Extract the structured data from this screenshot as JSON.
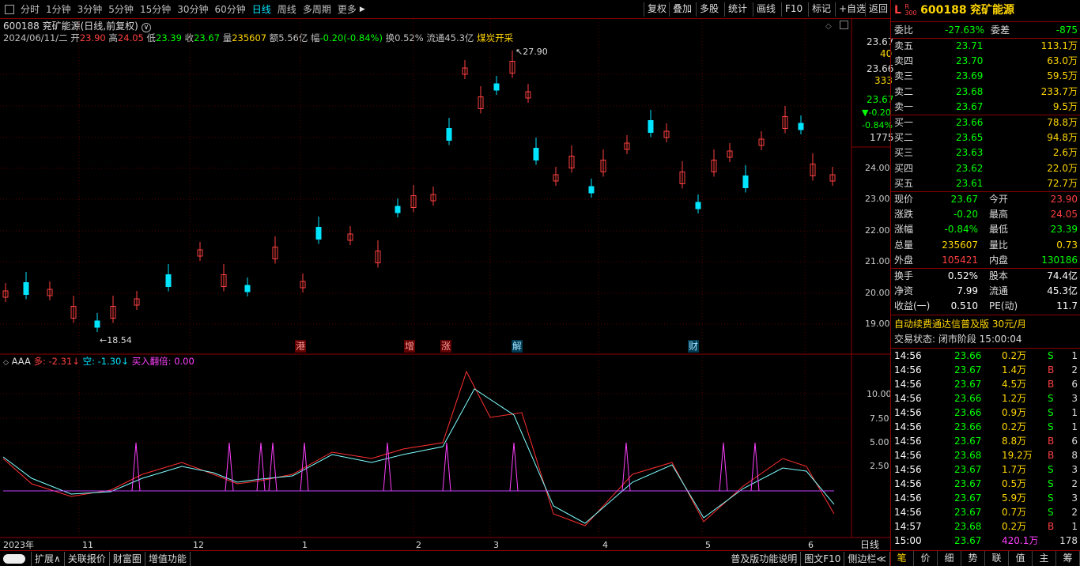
{
  "toolbar": {
    "periods": [
      "分时",
      "1分钟",
      "3分钟",
      "5分钟",
      "15分钟",
      "30分钟",
      "60分钟",
      "日线",
      "周线",
      "多周期",
      "更多"
    ],
    "active_index": 7,
    "tools": [
      "复权",
      "叠加",
      "多股",
      "统计",
      "画线",
      "F10",
      "标记",
      "+自选",
      "返回"
    ]
  },
  "info": {
    "line1": "600188 兖矿能源(日线,前复权)",
    "date": "2024/06/11/二",
    "open_l": "开",
    "open": "23.90",
    "high_l": "高",
    "high": "24.05",
    "low_l": "低",
    "low": "23.39",
    "close_l": "收",
    "close": "23.67",
    "vol_l": "量",
    "vol": "235607",
    "amt": "额5.56亿",
    "chg_l": "幅",
    "chg": "-0.20(-0.84%)",
    "turn": "换0.52%",
    "float": "流通45.3亿",
    "concept": "煤炭开采"
  },
  "chart_annotations": {
    "high_mark": "27.90",
    "low_mark": "18.54",
    "events": [
      "港",
      "增",
      "涨",
      "解",
      "财"
    ]
  },
  "price_axis": {
    "labels": [
      "24.00",
      "23.00",
      "22.00",
      "21.00",
      "20.00",
      "19.00"
    ],
    "top_box": [
      "23.67",
      "40",
      "23.66",
      "333",
      "23.67",
      "▼-0.20",
      "-0.84%",
      "1775"
    ]
  },
  "indicator": {
    "name": "AAA",
    "duo": "多: -2.31",
    "kong": "空: -1.30",
    "buy": "买入翻倍: 0.00",
    "axis": [
      "10.00",
      "7.50",
      "5.00",
      "2.50"
    ]
  },
  "x_axis": [
    "2023年",
    "11",
    "12",
    "1",
    "2",
    "3",
    "4",
    "5",
    "6"
  ],
  "period_label": "日线",
  "bottom": {
    "left": [
      "扩展∧",
      "关联报价",
      "财富圈",
      "增值功能"
    ],
    "right": [
      "普及版功能说明",
      "图文F10",
      "侧边栏≪"
    ]
  },
  "panel": {
    "code": "600188",
    "name": "兖矿能源",
    "badge": "R\n300",
    "weibi_l": "委比",
    "weibi": "-27.63%",
    "weicha_l": "委差",
    "weicha": "-875",
    "asks": [
      [
        "卖五",
        "23.71",
        "113.1万"
      ],
      [
        "卖四",
        "23.70",
        "63.0万"
      ],
      [
        "卖三",
        "23.69",
        "59.5万"
      ],
      [
        "卖二",
        "23.68",
        "233.7万"
      ],
      [
        "卖一",
        "23.67",
        "9.5万"
      ]
    ],
    "bids": [
      [
        "买一",
        "23.66",
        "78.8万"
      ],
      [
        "买二",
        "23.65",
        "94.8万"
      ],
      [
        "买三",
        "23.63",
        "2.6万"
      ],
      [
        "买四",
        "23.62",
        "22.0万"
      ],
      [
        "买五",
        "23.61",
        "72.7万"
      ]
    ],
    "quote": [
      [
        "现价",
        "23.67",
        "今开",
        "23.90"
      ],
      [
        "涨跌",
        "-0.20",
        "最高",
        "24.05"
      ],
      [
        "涨幅",
        "-0.84%",
        "最低",
        "23.39"
      ],
      [
        "总量",
        "235607",
        "量比",
        "0.73"
      ],
      [
        "外盘",
        "105421",
        "内盘",
        "130186"
      ]
    ],
    "stats": [
      [
        "换手",
        "0.52%",
        "股本",
        "74.4亿"
      ],
      [
        "净资",
        "7.99",
        "流通",
        "45.3亿"
      ],
      [
        "收益(一)",
        "0.510",
        "PE(动)",
        "11.7"
      ]
    ],
    "promo": "自动续费通达信普及版",
    "price": "30元/月",
    "status": "交易状态: 闭市阶段 15:00:04",
    "ticks": [
      [
        "14:56",
        "23.66",
        "0.2万",
        "S",
        "1"
      ],
      [
        "14:56",
        "23.67",
        "1.4万",
        "B",
        "2"
      ],
      [
        "14:56",
        "23.67",
        "4.5万",
        "B",
        "6"
      ],
      [
        "14:56",
        "23.66",
        "1.2万",
        "S",
        "3"
      ],
      [
        "14:56",
        "23.66",
        "0.9万",
        "S",
        "1"
      ],
      [
        "14:56",
        "23.66",
        "0.2万",
        "S",
        "1"
      ],
      [
        "14:56",
        "23.67",
        "8.8万",
        "B",
        "6"
      ],
      [
        "14:56",
        "23.68",
        "19.2万",
        "B",
        "8"
      ],
      [
        "14:56",
        "23.67",
        "1.7万",
        "S",
        "3"
      ],
      [
        "14:56",
        "23.67",
        "0.5万",
        "S",
        "2"
      ],
      [
        "14:56",
        "23.67",
        "5.9万",
        "S",
        "3"
      ],
      [
        "14:56",
        "23.67",
        "0.7万",
        "S",
        "2"
      ],
      [
        "14:57",
        "23.68",
        "0.2万",
        "B",
        "1"
      ],
      [
        "15:00",
        "23.67",
        "420.1万",
        "",
        "178"
      ]
    ],
    "tabs": [
      "笔",
      "价",
      "细",
      "势",
      "联",
      "值",
      "主",
      "筹"
    ]
  }
}
